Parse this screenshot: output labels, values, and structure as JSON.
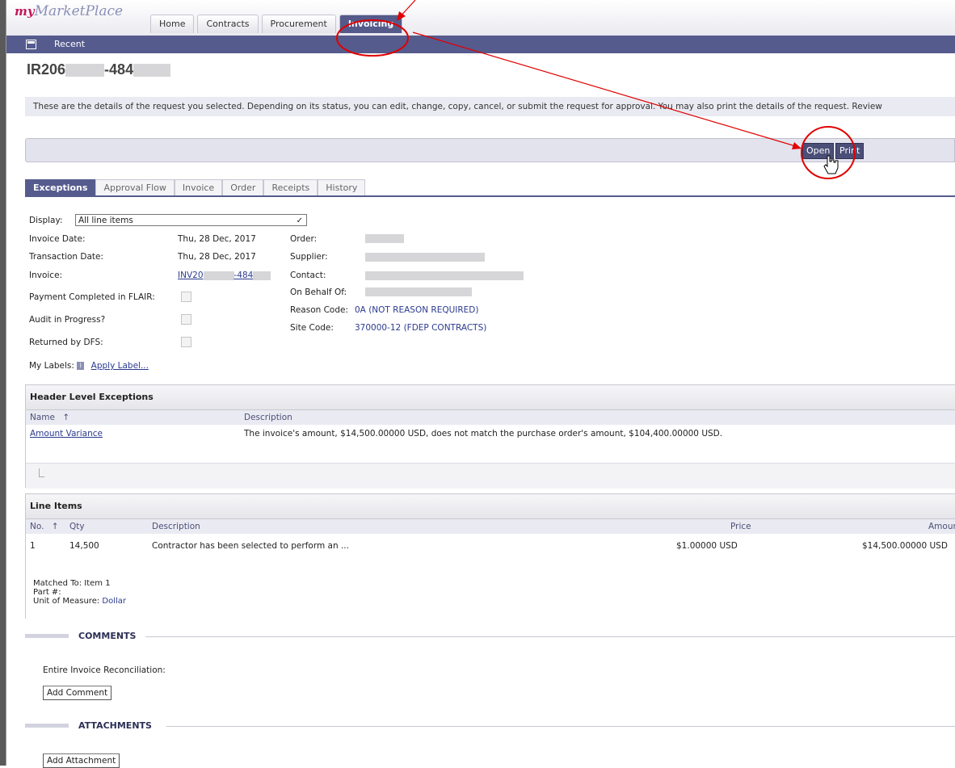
{
  "app": {
    "logo_my": "my",
    "logo_rest": "MarketPlace"
  },
  "nav": {
    "tabs": [
      {
        "label": "Home"
      },
      {
        "label": "Contracts"
      },
      {
        "label": "Procurement"
      },
      {
        "label": "Invoicing",
        "active": true
      }
    ]
  },
  "subnav": {
    "recent_label": "Recent"
  },
  "page": {
    "title_prefix": "IR206",
    "title_middle": "-484",
    "info_text": "These are the details of the request you selected. Depending on its status, you can edit, change, copy, cancel, or submit the request for approval. You may also print the details of the request. Review"
  },
  "actions": {
    "open_label": "Open",
    "print_label": "Print"
  },
  "detail_tabs": [
    {
      "label": "Exceptions",
      "active": true
    },
    {
      "label": "Approval Flow"
    },
    {
      "label": "Invoice"
    },
    {
      "label": "Order"
    },
    {
      "label": "Receipts"
    },
    {
      "label": "History"
    }
  ],
  "fields": {
    "display_label": "Display:",
    "display_value": "All line items",
    "invoice_date_label": "Invoice Date:",
    "invoice_date": "Thu, 28 Dec, 2017",
    "transaction_date_label": "Transaction Date:",
    "transaction_date": "Thu, 28 Dec, 2017",
    "invoice_label": "Invoice:",
    "invoice_prefix": "INV20",
    "invoice_middle": "-484",
    "payment_completed_label": "Payment Completed in FLAIR:",
    "audit_label": "Audit in Progress?",
    "returned_label": "Returned by DFS:",
    "my_labels_label": "My Labels:",
    "apply_label": "Apply Label...",
    "order_label": "Order:",
    "supplier_label": "Supplier:",
    "contact_label": "Contact:",
    "on_behalf_label": "On Behalf Of:",
    "reason_code_label": "Reason Code:",
    "reason_code": "0A (NOT REASON REQUIRED)",
    "site_code_label": "Site Code:",
    "site_code": "370000-12 (FDEP CONTRACTS)"
  },
  "header_exceptions": {
    "title": "Header Level Exceptions",
    "col_name": "Name",
    "col_description": "Description",
    "sort_arrow": "↑",
    "rows": [
      {
        "name": "Amount Variance",
        "description": "The invoice's amount, $14,500.00000 USD, does not match the purchase order's amount, $104,400.00000 USD."
      }
    ]
  },
  "line_items": {
    "title": "Line Items",
    "col_no": "No.",
    "sort_arrow": "↑",
    "col_qty": "Qty",
    "col_description": "Description",
    "col_price": "Price",
    "col_amount": "Amount",
    "rows": [
      {
        "no": "1",
        "qty": "14,500",
        "description": "Contractor has been selected to perform an ...",
        "price": "$1.00000 USD",
        "amount": "$14,500.00000 USD"
      }
    ],
    "matched_to": "Matched To: Item 1",
    "part_no": "Part #:",
    "uom_label": "Unit of Measure:",
    "uom_value": "Dollar"
  },
  "comments": {
    "title": "COMMENTS",
    "reconciliation_label": "Entire Invoice Reconciliation:",
    "add_comment_label": "Add Comment"
  },
  "attachments": {
    "title": "ATTACHMENTS",
    "add_attachment_label": "Add Attachment"
  },
  "colors": {
    "nav_active": "#555a8a",
    "annotation": "#e00000",
    "link": "#2b3a8f"
  }
}
